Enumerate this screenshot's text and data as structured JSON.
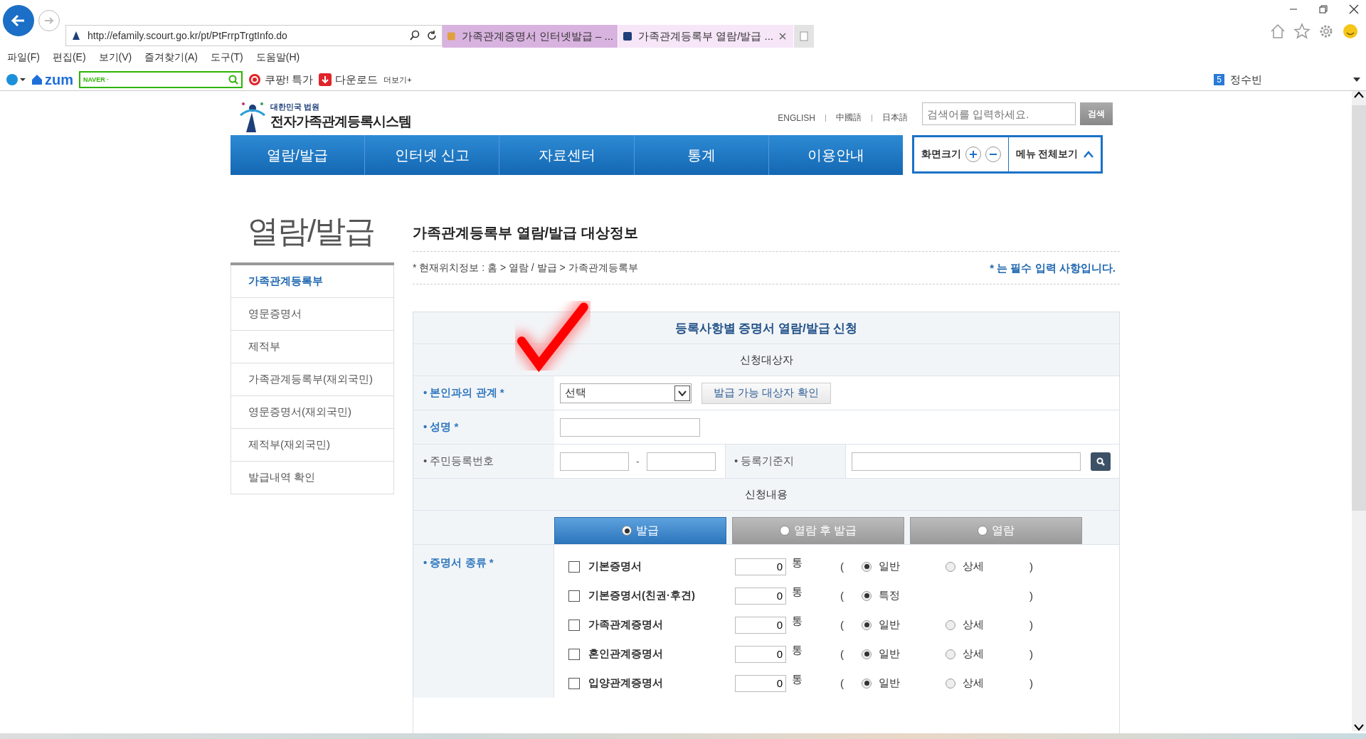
{
  "browser": {
    "address": "http://efamily.scourt.go.kr/pt/PtFrrpTrgtInfo.do",
    "tabs": [
      {
        "title": "가족관계증명서 인터넷발급 – ...",
        "selected": false
      },
      {
        "title": "가족관계등록부 열람/발급 ...",
        "selected": true
      }
    ],
    "menu": [
      "파일(F)",
      "편집(E)",
      "보기(V)",
      "즐겨찾기(A)",
      "도구(T)",
      "도움말(H)"
    ],
    "toolbar": {
      "brand": "zum",
      "search_brand": "NAVER ·",
      "links": [
        "쿠팡! 특가",
        "다운로드",
        "더보기+"
      ],
      "user_badge": "5",
      "user": "정수빈"
    }
  },
  "site": {
    "logo_small": "대한민국 법원",
    "logo_name": "전자가족관계등록시스템",
    "languages": [
      "ENGLISH",
      "中國語",
      "日本語"
    ],
    "search": {
      "placeholder": "검색어를 입력하세요.",
      "button": "검색"
    },
    "nav": [
      "열람/발급",
      "인터넷 신고",
      "자료센터",
      "통계",
      "이용안내"
    ],
    "zoom_label": "화면크기",
    "all_menu": "메뉴 전체보기"
  },
  "sidebar": {
    "title": "열람/발급",
    "items": [
      {
        "label": "가족관계등록부",
        "selected": true
      },
      {
        "label": "영문증명서",
        "selected": false
      },
      {
        "label": "제적부",
        "selected": false
      },
      {
        "label": "가족관계등록부(재외국민)",
        "selected": false
      },
      {
        "label": "영문증명서(재외국민)",
        "selected": false
      },
      {
        "label": "제적부(재외국민)",
        "selected": false
      },
      {
        "label": "발급내역 확인",
        "selected": false
      }
    ]
  },
  "heading": "가족관계등록부 열람/발급 대상정보",
  "breadcrumb": "* 현재위치정보 : 홈 > 열람 / 발급 > 가족관계등록부",
  "required_note": "* 는 필수 입력 사항입니다.",
  "annotation": {
    "kind": "checkmark"
  },
  "form": {
    "title": "등록사항별 증명서 열람/발급 신청",
    "section_applicant": "신청대상자",
    "relation": {
      "label": "• 본인과의 관계 *",
      "required": true,
      "select": "선택",
      "button": "발급 가능 대상자 확인"
    },
    "name": {
      "label": "• 성명 *",
      "required": true
    },
    "id_number": {
      "label": "• 주민등록번호",
      "required": false,
      "separator": "-"
    },
    "base": {
      "label": "• 등록기준지",
      "required": false
    },
    "section_request": "신청내용",
    "modes": [
      {
        "label": "발급",
        "selected": true
      },
      {
        "label": "열람 후 발급",
        "selected": false
      },
      {
        "label": "열람",
        "selected": false
      }
    ],
    "cert_label": "• 증명서 종류 *",
    "certificates": [
      {
        "name": "기본증명서",
        "checked": false,
        "copies": "0",
        "unit": "통",
        "open": "(",
        "close": ")",
        "options": [
          {
            "label": "일반",
            "selected": true
          },
          {
            "label": "상세",
            "selected": false
          }
        ]
      },
      {
        "name": "기본증명서(친권·후견)",
        "checked": false,
        "copies": "0",
        "unit": "통",
        "open": "(",
        "close": ")",
        "options": [
          {
            "label": "특정",
            "selected": true
          }
        ]
      },
      {
        "name": "가족관계증명서",
        "checked": false,
        "copies": "0",
        "unit": "통",
        "open": "(",
        "close": ")",
        "options": [
          {
            "label": "일반",
            "selected": true
          },
          {
            "label": "상세",
            "selected": false
          }
        ]
      },
      {
        "name": "혼인관계증명서",
        "checked": false,
        "copies": "0",
        "unit": "통",
        "open": "(",
        "close": ")",
        "options": [
          {
            "label": "일반",
            "selected": true
          },
          {
            "label": "상세",
            "selected": false
          }
        ]
      },
      {
        "name": "입양관계증명서",
        "checked": false,
        "copies": "0",
        "unit": "통",
        "open": "(",
        "close": ")",
        "options": [
          {
            "label": "일반",
            "selected": true
          },
          {
            "label": "상세",
            "selected": false
          }
        ]
      }
    ]
  }
}
